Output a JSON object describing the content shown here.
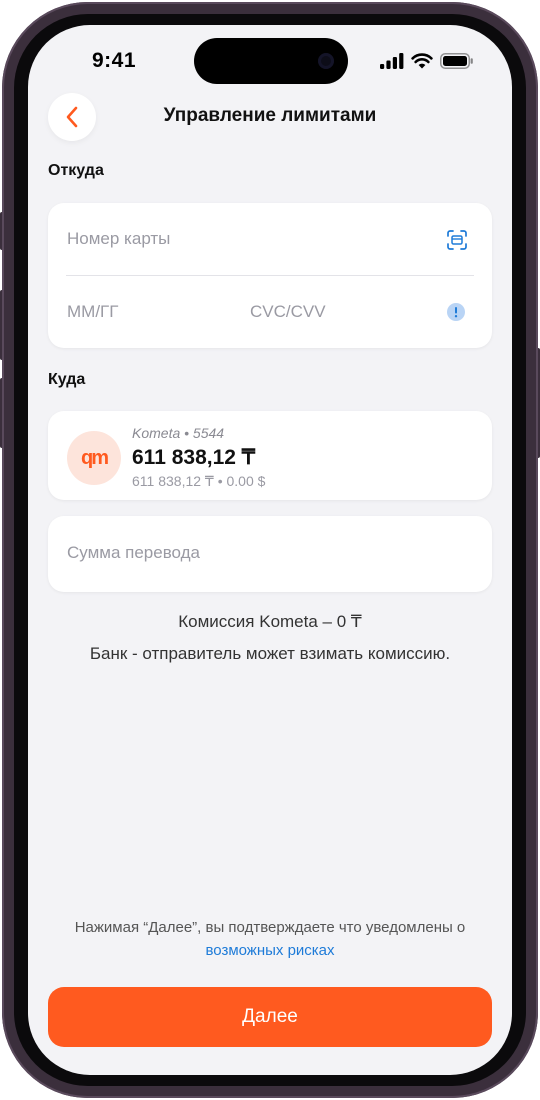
{
  "status_bar": {
    "time": "9:41"
  },
  "header": {
    "title": "Управление лимитами"
  },
  "from_section": {
    "label": "Откуда",
    "card_number_placeholder": "Номер карты",
    "expiry_placeholder": "ММ/ГГ",
    "cvc_placeholder": "CVC/CVV"
  },
  "to_section": {
    "label": "Куда",
    "account": {
      "logo_text": "qm",
      "name": "Kometa",
      "last_digits": "5544",
      "name_line": "Kometa  •  5544",
      "balance": "611 838,12 ₸",
      "sub_line": "611 838,12 ₸  •  0.00 $"
    }
  },
  "amount": {
    "placeholder": "Сумма перевода"
  },
  "commission": {
    "line1": "Комиссия Kometa – 0 ₸",
    "line2": "Банк - отправитель может взимать комиссию."
  },
  "disclaimer": {
    "text_before": "Нажимая “Далее”, вы подтверждаете что уведомлены о",
    "link_text": "возможных рисках"
  },
  "next_button": {
    "label": "Далее"
  },
  "colors": {
    "accent": "#ff5a1f",
    "link": "#1e7bd8",
    "background": "#f3f3f6"
  },
  "icons": [
    "chevron-left-icon",
    "scan-card-icon",
    "info-icon",
    "signal-icon",
    "wifi-icon",
    "battery-icon"
  ]
}
